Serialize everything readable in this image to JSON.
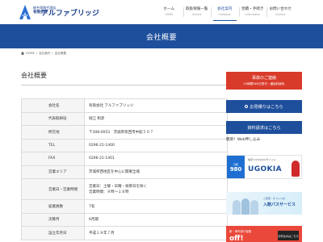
{
  "header": {
    "logo_small": "総合保険代理店",
    "logo_pre": "有限会社",
    "logo_main": "アルファブリッジ",
    "nav": [
      {
        "ja": "ホーム",
        "en": "HOME",
        "active": false
      },
      {
        "ja": "取扱保険一覧",
        "en": "Service",
        "active": false
      },
      {
        "ja": "会社案内",
        "en": "Company",
        "active": true
      },
      {
        "ja": "見積・手続き",
        "en": "Information",
        "active": false
      },
      {
        "ja": "お問い合わせ",
        "en": "Contact",
        "active": false
      }
    ]
  },
  "banner": {
    "title": "会社概要"
  },
  "breadcrumb": {
    "home": "HOME",
    "sep1": "/",
    "crumb1": "会社案内",
    "sep2": "/",
    "crumb2": "会社概要"
  },
  "main": {
    "section_title": "会社概要",
    "rows": [
      {
        "key": "会社名",
        "value": "有限会社 アルファブリッジ"
      },
      {
        "key": "代表取締役",
        "value": "堀江 和彦"
      },
      {
        "key": "所在地",
        "value": "〒308-0053　茨城県筑西市中館５０７"
      },
      {
        "key": "TEL",
        "value": "0296-21-1400"
      },
      {
        "key": "FAX",
        "value": "0296-21-1401"
      },
      {
        "key": "営業エリア",
        "value": "茨城県西地区を中心に関東全域"
      },
      {
        "key": "営業日・営業時間",
        "lines": [
          "営業日：土曜・日曜・祝祭日を除く",
          "営業時間：９時～１８時"
        ]
      },
      {
        "key": "従業員数",
        "value": "7名"
      },
      {
        "key": "決算月",
        "value": "6月期"
      },
      {
        "key": "設立年月日",
        "value": "平成１９年７月"
      }
    ]
  },
  "sidebar": {
    "contact_title": "事故のご連絡",
    "contact_sub": "24時間365日受付・通話料無料",
    "estimate_label": "お見積りはこちら",
    "doc_label": "資料請求はこちら",
    "web_label": "簡単！Web申し込み",
    "ad1": {
      "head": "格安スマホのUQモバイル",
      "price_small": "月額",
      "price": "980",
      "brand": "UGOKIA"
    },
    "ad2": {
      "kicker": "ご自宅・オフィスの",
      "title": "入館パスサービス"
    },
    "ad3": {
      "head": "新・海外旅行保険",
      "big": "off!",
      "btn": "お申込みはこちら"
    }
  },
  "colors": {
    "primary": "#1e4f9c",
    "accent": "#d93b2b"
  }
}
